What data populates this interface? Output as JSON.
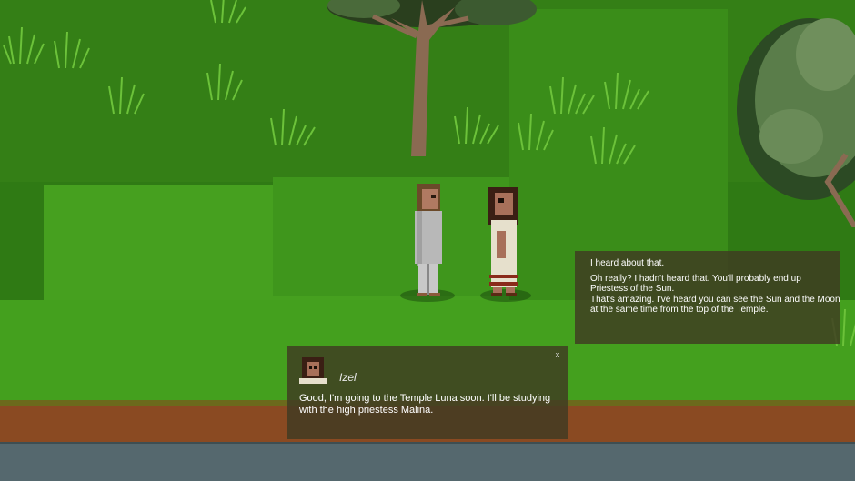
{
  "dialog": {
    "speaker": "Izel",
    "text": "Good, I'm going to the Temple Luna soon. I'll be studying with the high priestess Malina.",
    "close_label": "x"
  },
  "history": {
    "lines": [
      "I heard about that.",
      "Oh really? I hadn't heard that. You'll probably end up Priestess of the Sun.",
      "That's amazing. I've heard you can see the Sun and the Moon at the same time from the top of the Temple."
    ]
  },
  "colors": {
    "grass_dark": "#2f7a14",
    "grass_light": "#46a01f",
    "dirt": "#8a4a22",
    "water": "#55686e",
    "panel": "rgba(64,58,34,0.82)"
  }
}
